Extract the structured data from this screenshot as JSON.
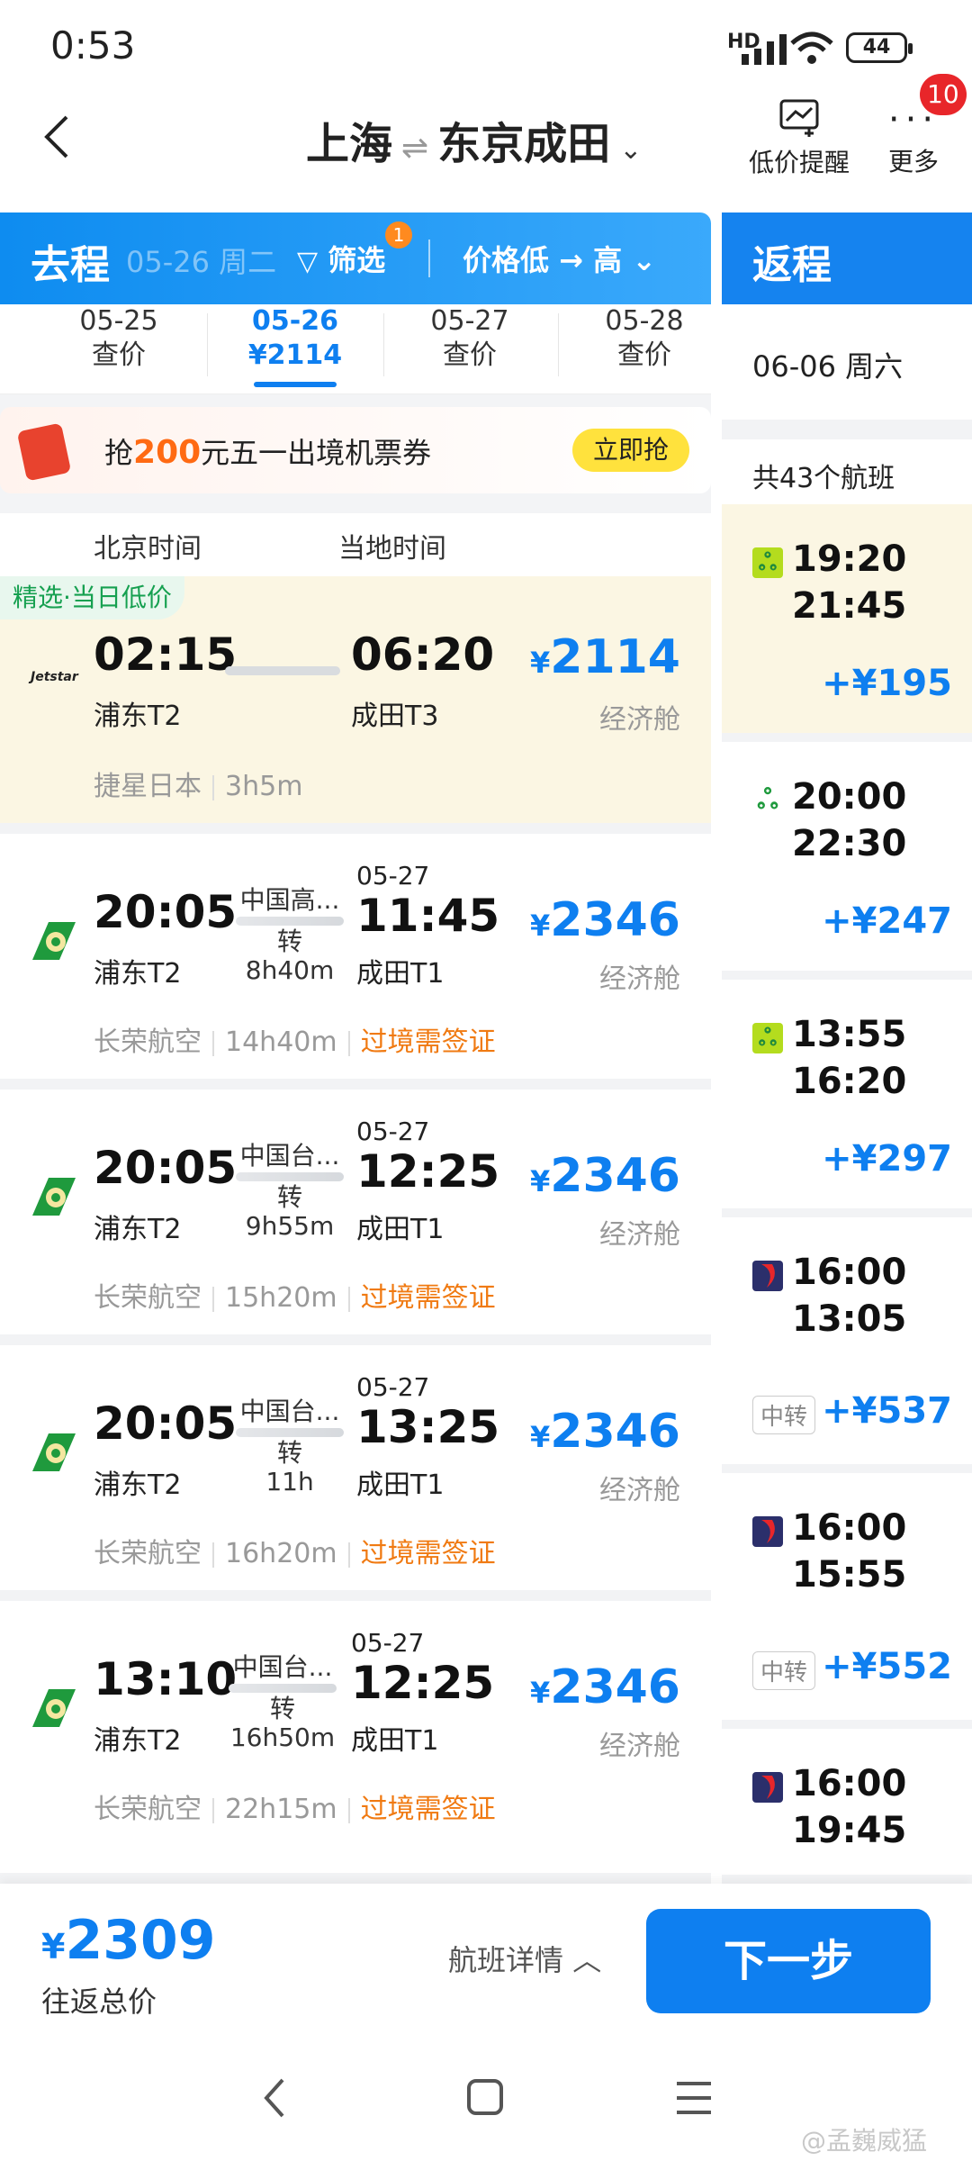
{
  "status": {
    "time": "0:53",
    "network": "HD",
    "battery": "44"
  },
  "header": {
    "from": "上海",
    "to": "东京成田",
    "alert_label": "低价提醒",
    "more_label": "更多",
    "more_badge": "10"
  },
  "outbound_tab": {
    "title": "去程",
    "date": "05-26 周二",
    "filter_label": "筛选",
    "filter_badge": "1",
    "sort_label": "价格低 → 高"
  },
  "return_tab": {
    "title": "返程"
  },
  "dates": [
    {
      "date": "05-25",
      "price": "查价"
    },
    {
      "date": "05-26",
      "price": "¥2114"
    },
    {
      "date": "05-27",
      "price": "查价"
    },
    {
      "date": "05-28",
      "price": "查价"
    }
  ],
  "promo": {
    "prefix": "抢",
    "amount": "200",
    "suffix": "元五一出境机票券",
    "button": "立即抢"
  },
  "list_header": {
    "beijing": "北京时间",
    "local": "当地时间"
  },
  "flights": [
    {
      "tag": "精选·当日低价",
      "dep": "02:15",
      "dep_term": "浦东T2",
      "arr": "06:20",
      "arr_term": "成田T3",
      "price": "2114",
      "cabin": "经济舱",
      "airline": "捷星日本",
      "duration": "3h5m",
      "logo": "Jetstar"
    },
    {
      "dep": "20:05",
      "dep_term": "浦东T2",
      "transit_city": "中国高...",
      "transit_label": "转",
      "transit_time": "8h40m",
      "next_date": "05-27",
      "arr": "11:45",
      "arr_term": "成田T1",
      "price": "2346",
      "cabin": "经济舱",
      "airline": "长荣航空",
      "duration": "14h40m",
      "visa": "过境需签证"
    },
    {
      "dep": "20:05",
      "dep_term": "浦东T2",
      "transit_city": "中国台...",
      "transit_label": "转",
      "transit_time": "9h55m",
      "next_date": "05-27",
      "arr": "12:25",
      "arr_term": "成田T1",
      "price": "2346",
      "cabin": "经济舱",
      "airline": "长荣航空",
      "duration": "15h20m",
      "visa": "过境需签证"
    },
    {
      "dep": "20:05",
      "dep_term": "浦东T2",
      "transit_city": "中国台...",
      "transit_label": "转",
      "transit_time": "11h",
      "next_date": "05-27",
      "arr": "13:25",
      "arr_term": "成田T1",
      "price": "2346",
      "cabin": "经济舱",
      "airline": "长荣航空",
      "duration": "16h20m",
      "visa": "过境需签证"
    },
    {
      "dep": "13:10",
      "dep_term": "浦东T2",
      "transit_city": "中国台...",
      "transit_label": "转",
      "transit_time": "16h50m",
      "next_date": "05-27",
      "arr": "12:25",
      "arr_term": "成田T1",
      "price": "2346",
      "cabin": "经济舱",
      "airline": "长荣航空",
      "duration": "22h15m",
      "visa": "过境需签证"
    }
  ],
  "return": {
    "date": "06-06 周六",
    "count": "共43个航班",
    "flights": [
      {
        "dep": "19:20",
        "arr": "21:45",
        "price": "+¥195",
        "icon": "spring-airlines-icon"
      },
      {
        "dep": "20:00",
        "arr": "22:30",
        "price": "+¥247",
        "icon": "spring-airlines-icon"
      },
      {
        "dep": "13:55",
        "arr": "16:20",
        "price": "+¥297",
        "icon": "spring-airlines-icon"
      },
      {
        "dep": "16:00",
        "arr": "13:05",
        "price": "+¥537",
        "transfer": "中转",
        "icon": "airline-flag-icon"
      },
      {
        "dep": "16:00",
        "arr": "15:55",
        "price": "+¥552",
        "transfer": "中转",
        "icon": "airline-flag-icon"
      },
      {
        "dep": "16:00",
        "arr": "19:45",
        "icon": "airline-flag-icon"
      }
    ]
  },
  "bottom": {
    "yen": "¥",
    "total": "2309",
    "total_label": "往返总价",
    "detail_label": "航班详情",
    "next_label": "下一步"
  },
  "watermark": "@孟巍威猛",
  "colors": {
    "accent": "#0e7ff0",
    "visa": "#f07a12",
    "highlight": "#fbf6e3"
  }
}
